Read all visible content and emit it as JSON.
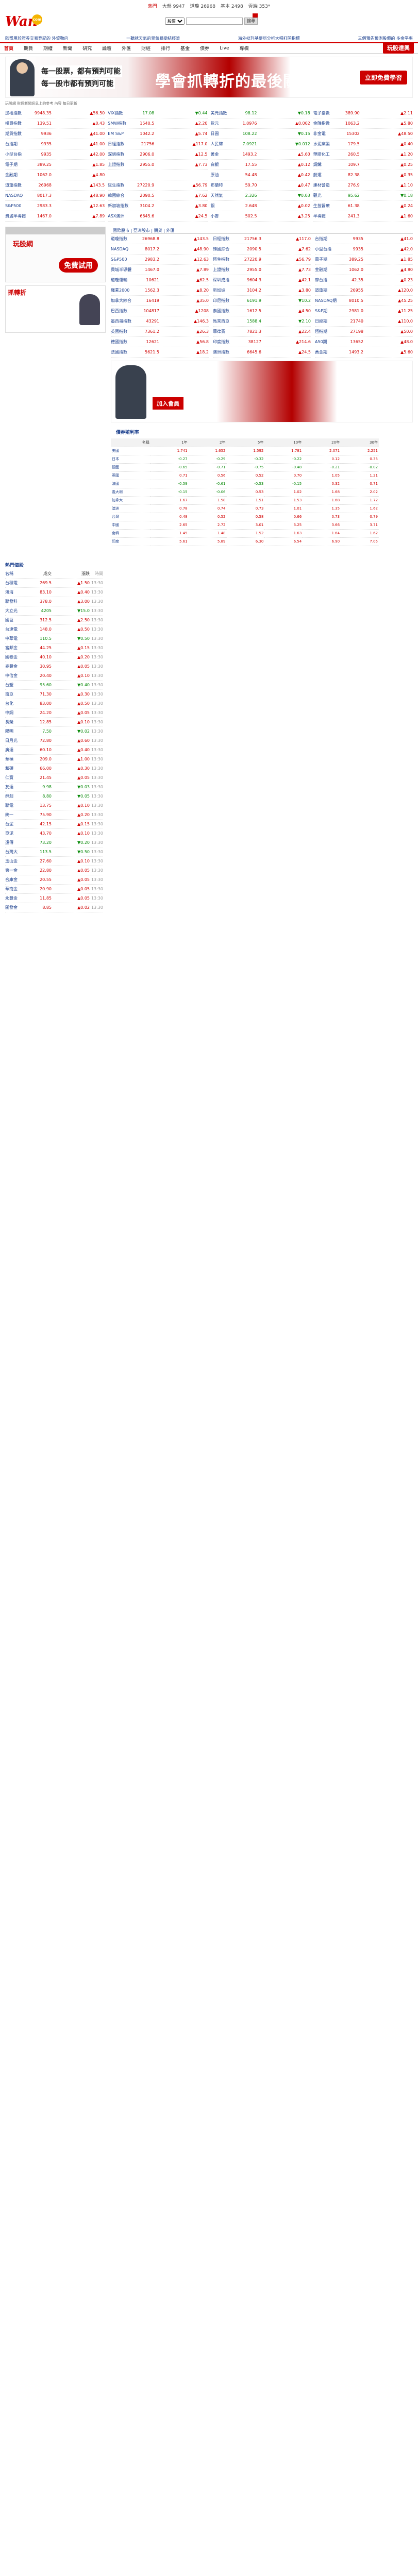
{
  "topbar": {
    "items": [
      "熱門",
      "大盤 9947",
      "道瓊 26968",
      "基本 2498",
      "雲端 353*"
    ]
  },
  "header": {
    "logo_text": "Wan",
    "logo_badge": "com",
    "search_select": "股票",
    "search_btn": "搜尋"
  },
  "newslinks": [
    "歐盟用於證券交易登記的 外資動向",
    "一聽就天氣的景氣易變結經濟",
    "海外批刊基要所分析大幅打開指標",
    "三個預先預測股價的 多金平率"
  ],
  "nav": {
    "items": [
      "首頁",
      "期貨",
      "期權",
      "新聞",
      "研究",
      "論壇",
      "外匯",
      "財經",
      "排行",
      "基金",
      "債券",
      "Live",
      "專欄"
    ],
    "active_index": 0,
    "promo": "玩股達興"
  },
  "banner": {
    "line1": "每一股票，都有預判可能",
    "line2": "每一股市都有預判可能",
    "big": "學會抓轉折的最後關鍵",
    "big_highlight": "抓轉折",
    "button": "立即免費學習"
  },
  "small_note": "玩股網 財經新聞訊息上的參考 內容 每日更新",
  "top_quotes": [
    [
      {
        "name": "加權指數",
        "price": "9948.35",
        "change": "▲56.50",
        "dir": "up"
      },
      {
        "name": "櫃買指數",
        "price": "139.51",
        "change": "▲0.43",
        "dir": "up"
      },
      {
        "name": "期貨指數",
        "price": "9936",
        "change": "▲41.00",
        "dir": "up"
      },
      {
        "name": "台指期",
        "price": "9935",
        "change": "▲41.00",
        "dir": "up"
      },
      {
        "name": "小型台指",
        "price": "9935",
        "change": "▲42.00",
        "dir": "up"
      },
      {
        "name": "電子期",
        "price": "389.25",
        "change": "▲1.85",
        "dir": "up"
      },
      {
        "name": "金融期",
        "price": "1062.0",
        "change": "▲4.80",
        "dir": "up"
      },
      {
        "name": "道瓊指數",
        "price": "26968",
        "change": "▲143.5",
        "dir": "up"
      },
      {
        "name": "NASDAQ",
        "price": "8017.3",
        "change": "▲48.90",
        "dir": "up"
      },
      {
        "name": "S&P500",
        "price": "2983.3",
        "change": "▲12.63",
        "dir": "up"
      },
      {
        "name": "費城半導體",
        "price": "1467.0",
        "change": "▲7.89",
        "dir": "up"
      }
    ],
    [
      {
        "name": "VIX指數",
        "price": "17.08",
        "change": "▼0.44",
        "dir": "dn"
      },
      {
        "name": "SMW指數",
        "price": "1540.5",
        "change": "▲2.20",
        "dir": "up"
      },
      {
        "name": "EM S&P",
        "price": "1042.2",
        "change": "▲5.74",
        "dir": "up"
      },
      {
        "name": "日經指數",
        "price": "21756",
        "change": "▲117.0",
        "dir": "up"
      },
      {
        "name": "深圳指數",
        "price": "2906.0",
        "change": "▲12.5",
        "dir": "up"
      },
      {
        "name": "上證指數",
        "price": "2955.0",
        "change": "▲7.73",
        "dir": "up"
      },
      {
        "name": "",
        "price": "",
        "change": "",
        "dir": "up"
      },
      {
        "name": "恆生指數",
        "price": "27220.9",
        "change": "▲56.79",
        "dir": "up"
      },
      {
        "name": "韓國綜合",
        "price": "2090.5",
        "change": "▲7.62",
        "dir": "up"
      },
      {
        "name": "新加坡指數",
        "price": "3104.2",
        "change": "▲3.80",
        "dir": "up"
      },
      {
        "name": "ASX澳洲",
        "price": "6645.6",
        "change": "▲24.5",
        "dir": "up"
      }
    ],
    [
      {
        "name": "美元指數",
        "price": "98.12",
        "change": "▼0.18",
        "dir": "dn"
      },
      {
        "name": "歐元",
        "price": "1.0976",
        "change": "▲0.002",
        "dir": "up"
      },
      {
        "name": "日圓",
        "price": "108.22",
        "change": "▼0.15",
        "dir": "dn"
      },
      {
        "name": "人民幣",
        "price": "7.0921",
        "change": "▼0.012",
        "dir": "dn"
      },
      {
        "name": "黃金",
        "price": "1493.2",
        "change": "▲5.60",
        "dir": "up"
      },
      {
        "name": "白銀",
        "price": "17.55",
        "change": "▲0.12",
        "dir": "up"
      },
      {
        "name": "原油",
        "price": "54.48",
        "change": "▲0.42",
        "dir": "up"
      },
      {
        "name": "布蘭特",
        "price": "59.70",
        "change": "▲0.47",
        "dir": "up"
      },
      {
        "name": "天然氣",
        "price": "2.326",
        "change": "▼0.03",
        "dir": "dn"
      },
      {
        "name": "銅",
        "price": "2.648",
        "change": "▲0.02",
        "dir": "up"
      },
      {
        "name": "小麥",
        "price": "502.5",
        "change": "▲3.25",
        "dir": "up"
      }
    ],
    [
      {
        "name": "電子指數",
        "price": "389.90",
        "change": "▲2.11",
        "dir": "up"
      },
      {
        "name": "金融指數",
        "price": "1063.2",
        "change": "▲5.80",
        "dir": "up"
      },
      {
        "name": "非金電",
        "price": "15302",
        "change": "▲48.50",
        "dir": "up"
      },
      {
        "name": "水泥窯製",
        "price": "179.5",
        "change": "▲0.40",
        "dir": "up"
      },
      {
        "name": "塑膠化工",
        "price": "260.5",
        "change": "▲1.20",
        "dir": "up"
      },
      {
        "name": "鋼鐵",
        "price": "109.7",
        "change": "▲0.25",
        "dir": "up"
      },
      {
        "name": "航運",
        "price": "82.38",
        "change": "▲0.35",
        "dir": "up"
      },
      {
        "name": "建材營造",
        "price": "276.9",
        "change": "▲1.10",
        "dir": "up"
      },
      {
        "name": "觀光",
        "price": "95.62",
        "change": "▼0.18",
        "dir": "dn"
      },
      {
        "name": "生技醫療",
        "price": "61.38",
        "change": "▲0.24",
        "dir": "up"
      },
      {
        "name": "半導體",
        "price": "241.3",
        "change": "▲1.60",
        "dir": "up"
      }
    ]
  ],
  "tabline": "國際股市 | 亞洲股市 | 期貨 | 外匯",
  "ads": {
    "left1_red": "玩股網",
    "left1_btn": "免費試用",
    "left2_hdr": "抓轉折",
    "tower_title": "學會抓轉折",
    "tower_sub": "的最後關鍵",
    "tower_btn": "加入會員"
  },
  "mid_quotes": [
    [
      {
        "name": "道瓊指數",
        "price": "26968.8",
        "change": "▲143.5",
        "dir": "up"
      },
      {
        "name": "NASDAQ",
        "price": "8017.2",
        "change": "▲48.90",
        "dir": "up"
      },
      {
        "name": "S&P500",
        "price": "2983.2",
        "change": "▲12.63",
        "dir": "up"
      },
      {
        "name": "費城半導體",
        "price": "1467.0",
        "change": "▲7.89",
        "dir": "up"
      },
      {
        "name": "道瓊運輸",
        "price": "10621",
        "change": "▲62.5",
        "dir": "up"
      },
      {
        "name": "羅素2000",
        "price": "1562.3",
        "change": "▲8.20",
        "dir": "up"
      },
      {
        "name": "加拿大綜合",
        "price": "16419",
        "change": "▲35.0",
        "dir": "up"
      },
      {
        "name": "巴西指數",
        "price": "104817",
        "change": "▲1208",
        "dir": "up"
      },
      {
        "name": "墨西哥指數",
        "price": "43291",
        "change": "▲146.3",
        "dir": "up"
      },
      {
        "name": "英國指數",
        "price": "7361.2",
        "change": "▲26.3",
        "dir": "up"
      },
      {
        "name": "德國指數",
        "price": "12621",
        "change": "▲56.8",
        "dir": "up"
      },
      {
        "name": "法國指數",
        "price": "5621.5",
        "change": "▲18.2",
        "dir": "up"
      }
    ],
    [
      {
        "name": "日經指數",
        "price": "21756.3",
        "change": "▲117.0",
        "dir": "up"
      },
      {
        "name": "韓國綜合",
        "price": "2090.5",
        "change": "▲7.62",
        "dir": "up"
      },
      {
        "name": "恆生指數",
        "price": "27220.9",
        "change": "▲56.79",
        "dir": "up"
      },
      {
        "name": "上證指數",
        "price": "2955.0",
        "change": "▲7.73",
        "dir": "up"
      },
      {
        "name": "深圳成指",
        "price": "9604.3",
        "change": "▲42.1",
        "dir": "up"
      },
      {
        "name": "新加坡",
        "price": "3104.2",
        "change": "▲3.80",
        "dir": "up"
      },
      {
        "name": "印尼指數",
        "price": "6191.9",
        "change": "▼10.2",
        "dir": "dn"
      },
      {
        "name": "泰國指數",
        "price": "1612.5",
        "change": "▲4.50",
        "dir": "up"
      },
      {
        "name": "馬來西亞",
        "price": "1588.4",
        "change": "▼2.10",
        "dir": "dn"
      },
      {
        "name": "菲律賓",
        "price": "7821.3",
        "change": "▲22.4",
        "dir": "up"
      },
      {
        "name": "印度指數",
        "price": "38127",
        "change": "▲214.6",
        "dir": "up"
      },
      {
        "name": "澳洲指數",
        "price": "6645.6",
        "change": "▲24.5",
        "dir": "up"
      }
    ],
    [
      {
        "name": "台指期",
        "price": "9935",
        "change": "▲41.0",
        "dir": "up"
      },
      {
        "name": "小型台指",
        "price": "9935",
        "change": "▲42.0",
        "dir": "up"
      },
      {
        "name": "電子期",
        "price": "389.25",
        "change": "▲1.85",
        "dir": "up"
      },
      {
        "name": "金融期",
        "price": "1062.0",
        "change": "▲4.80",
        "dir": "up"
      },
      {
        "name": "摩台指",
        "price": "42.35",
        "change": "▲0.23",
        "dir": "up"
      },
      {
        "name": "道瓊期",
        "price": "26955",
        "change": "▲120.0",
        "dir": "up"
      },
      {
        "name": "NASDAQ期",
        "price": "8010.5",
        "change": "▲45.25",
        "dir": "up"
      },
      {
        "name": "S&P期",
        "price": "2981.0",
        "change": "▲11.25",
        "dir": "up"
      },
      {
        "name": "日經期",
        "price": "21740",
        "change": "▲110.0",
        "dir": "up"
      },
      {
        "name": "恆指期",
        "price": "27198",
        "change": "▲50.0",
        "dir": "up"
      },
      {
        "name": "A50期",
        "price": "13652",
        "change": "▲48.0",
        "dir": "up"
      },
      {
        "name": "黃金期",
        "price": "1493.2",
        "change": "▲5.60",
        "dir": "up"
      }
    ]
  ],
  "stock_section": {
    "title": "熱門個股",
    "headers": [
      "名稱",
      "成交",
      "漲跌",
      "時間"
    ],
    "rows": [
      {
        "name": "台積電",
        "price": "269.5",
        "change": "▲1.50",
        "dir": "up",
        "time": "13:30"
      },
      {
        "name": "鴻海",
        "price": "83.10",
        "change": "▲0.40",
        "dir": "up",
        "time": "13:30"
      },
      {
        "name": "聯發科",
        "price": "378.0",
        "change": "▲3.00",
        "dir": "up",
        "time": "13:30"
      },
      {
        "name": "大立光",
        "price": "4205",
        "change": "▼15.0",
        "dir": "dn",
        "time": "13:30"
      },
      {
        "name": "國巨",
        "price": "312.5",
        "change": "▲2.50",
        "dir": "up",
        "time": "13:30"
      },
      {
        "name": "台達電",
        "price": "148.0",
        "change": "▲0.50",
        "dir": "up",
        "time": "13:30"
      },
      {
        "name": "中華電",
        "price": "110.5",
        "change": "▼0.50",
        "dir": "dn",
        "time": "13:30"
      },
      {
        "name": "富邦金",
        "price": "44.25",
        "change": "▲0.15",
        "dir": "up",
        "time": "13:30"
      },
      {
        "name": "國泰金",
        "price": "40.10",
        "change": "▲0.20",
        "dir": "up",
        "time": "13:30"
      },
      {
        "name": "兆豐金",
        "price": "30.95",
        "change": "▲0.05",
        "dir": "up",
        "time": "13:30"
      },
      {
        "name": "中信金",
        "price": "20.40",
        "change": "▲0.10",
        "dir": "up",
        "time": "13:30"
      },
      {
        "name": "台塑",
        "price": "95.60",
        "change": "▼0.40",
        "dir": "dn",
        "time": "13:30"
      },
      {
        "name": "南亞",
        "price": "71.30",
        "change": "▲0.30",
        "dir": "up",
        "time": "13:30"
      },
      {
        "name": "台化",
        "price": "83.00",
        "change": "▲0.50",
        "dir": "up",
        "time": "13:30"
      },
      {
        "name": "中鋼",
        "price": "24.20",
        "change": "▲0.05",
        "dir": "up",
        "time": "13:30"
      },
      {
        "name": "長榮",
        "price": "12.85",
        "change": "▲0.10",
        "dir": "up",
        "time": "13:30"
      },
      {
        "name": "陽明",
        "price": "7.50",
        "change": "▼0.02",
        "dir": "dn",
        "time": "13:30"
      },
      {
        "name": "日月光",
        "price": "72.80",
        "change": "▲0.60",
        "dir": "up",
        "time": "13:30"
      },
      {
        "name": "廣達",
        "price": "60.10",
        "change": "▲0.40",
        "dir": "up",
        "time": "13:30"
      },
      {
        "name": "華碩",
        "price": "209.0",
        "change": "▲1.00",
        "dir": "up",
        "time": "13:30"
      },
      {
        "name": "和碩",
        "price": "66.00",
        "change": "▲0.30",
        "dir": "up",
        "time": "13:30"
      },
      {
        "name": "仁寶",
        "price": "21.45",
        "change": "▲0.05",
        "dir": "up",
        "time": "13:30"
      },
      {
        "name": "友達",
        "price": "9.98",
        "change": "▼0.03",
        "dir": "dn",
        "time": "13:30"
      },
      {
        "name": "群創",
        "price": "8.80",
        "change": "▼0.05",
        "dir": "dn",
        "time": "13:30"
      },
      {
        "name": "聯電",
        "price": "13.75",
        "change": "▲0.10",
        "dir": "up",
        "time": "13:30"
      },
      {
        "name": "統一",
        "price": "75.90",
        "change": "▲0.20",
        "dir": "up",
        "time": "13:30"
      },
      {
        "name": "台泥",
        "price": "42.15",
        "change": "▲0.15",
        "dir": "up",
        "time": "13:30"
      },
      {
        "name": "亞泥",
        "price": "43.70",
        "change": "▲0.10",
        "dir": "up",
        "time": "13:30"
      },
      {
        "name": "遠傳",
        "price": "73.20",
        "change": "▼0.20",
        "dir": "dn",
        "time": "13:30"
      },
      {
        "name": "台灣大",
        "price": "113.5",
        "change": "▼0.50",
        "dir": "dn",
        "time": "13:30"
      },
      {
        "name": "玉山金",
        "price": "27.60",
        "change": "▲0.10",
        "dir": "up",
        "time": "13:30"
      },
      {
        "name": "第一金",
        "price": "22.80",
        "change": "▲0.05",
        "dir": "up",
        "time": "13:30"
      },
      {
        "name": "合庫金",
        "price": "20.55",
        "change": "▲0.05",
        "dir": "up",
        "time": "13:30"
      },
      {
        "name": "華南金",
        "price": "20.90",
        "change": "▲0.05",
        "dir": "up",
        "time": "13:30"
      },
      {
        "name": "永豐金",
        "price": "11.85",
        "change": "▲0.05",
        "dir": "up",
        "time": "13:30"
      },
      {
        "name": "開發金",
        "price": "8.85",
        "change": "▲0.02",
        "dir": "up",
        "time": "13:30"
      }
    ]
  },
  "bond_section": {
    "title": "債券殖利率",
    "headers": [
      "名稱",
      "1年",
      "2年",
      "5年",
      "10年",
      "20年",
      "30年"
    ],
    "rows": [
      [
        "美國",
        "1.741",
        "1.652",
        "1.592",
        "1.781",
        "2.071",
        "2.251"
      ],
      [
        "日本",
        "-0.27",
        "-0.29",
        "-0.32",
        "-0.22",
        "0.12",
        "0.35"
      ],
      [
        "德國",
        "-0.65",
        "-0.71",
        "-0.75",
        "-0.48",
        "-0.21",
        "-0.02"
      ],
      [
        "英國",
        "0.71",
        "0.56",
        "0.52",
        "0.70",
        "1.05",
        "1.21"
      ],
      [
        "法國",
        "-0.59",
        "-0.61",
        "-0.53",
        "-0.15",
        "0.32",
        "0.71"
      ],
      [
        "義大利",
        "-0.15",
        "-0.06",
        "0.53",
        "1.02",
        "1.68",
        "2.02"
      ],
      [
        "加拿大",
        "1.67",
        "1.58",
        "1.51",
        "1.53",
        "1.68",
        "1.72"
      ],
      [
        "澳洲",
        "0.78",
        "0.74",
        "0.73",
        "1.01",
        "1.35",
        "1.62"
      ],
      [
        "台灣",
        "0.48",
        "0.52",
        "0.58",
        "0.66",
        "0.73",
        "0.79"
      ],
      [
        "中國",
        "2.65",
        "2.72",
        "3.01",
        "3.25",
        "3.66",
        "3.71"
      ],
      [
        "南韓",
        "1.45",
        "1.48",
        "1.52",
        "1.63",
        "1.64",
        "1.62"
      ],
      [
        "印度",
        "5.61",
        "5.89",
        "6.30",
        "6.54",
        "6.90",
        "7.05"
      ]
    ]
  }
}
